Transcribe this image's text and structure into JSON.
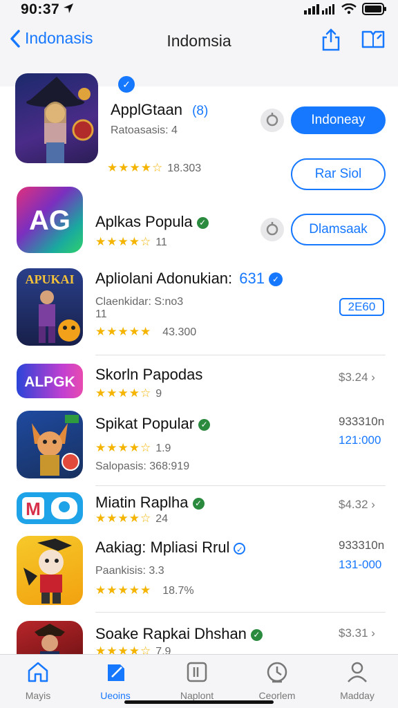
{
  "status": {
    "time": "90:37"
  },
  "nav": {
    "back_label": "Indonasis",
    "title": "Indomsia"
  },
  "apps": [
    {
      "title": "ApplGtaan",
      "badge": "(8)",
      "subtitle": "Ratoasasis: 4",
      "rating_count": "18.303",
      "primary_button": "Indoneay",
      "secondary_button": "Rar Siol"
    },
    {
      "title": "Aplkas Popula",
      "rating_count": "11",
      "button": "Dlamsaak"
    },
    {
      "title": "Apliolani Adonukian:",
      "badge": "631",
      "subtitle1": "Claenkidar: S:no3",
      "subtitle2": "11",
      "rating_count": "43.300",
      "button": "2E60"
    },
    {
      "title": "Skorln Papodas",
      "rating_count": "9",
      "price": "$3.24"
    },
    {
      "title": "Spikat Popular",
      "rating_count": "1.9",
      "subtitle": "Salopasis: 368:919",
      "price_line1": "933310n",
      "price_line2": "121:000"
    },
    {
      "title": "Miatin Raplha",
      "rating_count": "24",
      "price": "$4.32"
    },
    {
      "title": "Aakiag: Mpliasi Rrul",
      "subtitle": "Paankisis: 3.3",
      "rating_count": "18.7%",
      "price_line1": "933310n",
      "price_line2": "131-000"
    },
    {
      "title": "Soake Rapkai Dhshan",
      "rating_count": "7.9",
      "price": "$3.31"
    }
  ],
  "icons": {
    "app1": "witch-girl-icon",
    "app2": "ag-logo-icon",
    "app3": "apukai-hero-icon",
    "app4": "alpgk-logo-icon",
    "app5": "fox-warrior-icon",
    "app6": "m-logo-icon",
    "app7": "cartoon-character-icon",
    "app8": "pirate-icon"
  },
  "tabs": [
    {
      "label": "Mayis"
    },
    {
      "label": "Ueoins"
    },
    {
      "label": "Naplont"
    },
    {
      "label": "Ceorlem"
    },
    {
      "label": "Madday"
    }
  ],
  "colors": {
    "accent": "#1677ff",
    "star": "#f4b400",
    "verified": "#2a8a3e"
  }
}
